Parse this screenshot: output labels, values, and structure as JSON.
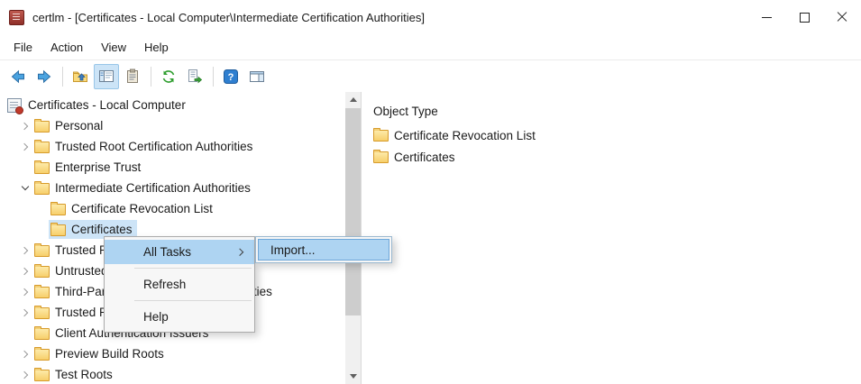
{
  "window": {
    "title": "certlm - [Certificates - Local Computer\\Intermediate Certification Authorities]",
    "controls": [
      {
        "name": "minimize"
      },
      {
        "name": "maximize"
      },
      {
        "name": "close"
      }
    ]
  },
  "menu_bar": {
    "items": [
      {
        "label": "File"
      },
      {
        "label": "Action"
      },
      {
        "label": "View"
      },
      {
        "label": "Help"
      }
    ]
  },
  "toolbar": {
    "help_glyph": "?",
    "buttons": [
      {
        "name": "back"
      },
      {
        "name": "forward"
      },
      {
        "name": "up-one-level"
      },
      {
        "name": "show-hide-console-tree",
        "active": true
      },
      {
        "name": "properties"
      },
      {
        "name": "refresh"
      },
      {
        "name": "export-list"
      },
      {
        "name": "help"
      },
      {
        "name": "show-hide-action-pane"
      }
    ]
  },
  "tree": {
    "items": [
      {
        "label": "Certificates - Local Computer",
        "level": 0,
        "chevron": "none",
        "icon": "root"
      },
      {
        "label": "Personal",
        "level": 1,
        "chevron": "collapsed",
        "icon": "folder"
      },
      {
        "label": "Trusted Root Certification Authorities",
        "level": 1,
        "chevron": "collapsed",
        "icon": "folder"
      },
      {
        "label": "Enterprise Trust",
        "level": 1,
        "chevron": "none",
        "icon": "folder"
      },
      {
        "label": "Intermediate Certification Authorities",
        "level": 1,
        "chevron": "expanded",
        "icon": "folder"
      },
      {
        "label": "Certificate Revocation List",
        "level": 2,
        "chevron": "none",
        "icon": "folder"
      },
      {
        "label": "Certificates",
        "level": 2,
        "chevron": "none",
        "icon": "folder",
        "selected": true
      },
      {
        "label": "Trusted Publishers",
        "level": 1,
        "chevron": "collapsed",
        "icon": "folder"
      },
      {
        "label": "Untrusted Certificates",
        "level": 1,
        "chevron": "collapsed",
        "icon": "folder"
      },
      {
        "label": "Third-Party Root Certification Authorities",
        "level": 1,
        "chevron": "collapsed",
        "icon": "folder"
      },
      {
        "label": "Trusted People",
        "level": 1,
        "chevron": "collapsed",
        "icon": "folder"
      },
      {
        "label": "Client Authentication Issuers",
        "level": 1,
        "chevron": "none",
        "icon": "folder"
      },
      {
        "label": "Preview Build Roots",
        "level": 1,
        "chevron": "collapsed",
        "icon": "folder"
      },
      {
        "label": "Test Roots",
        "level": 1,
        "chevron": "collapsed",
        "icon": "folder"
      }
    ]
  },
  "context_menu": {
    "items": [
      {
        "label": "All Tasks",
        "highlighted": true,
        "has_submenu": true
      },
      {
        "separator": true
      },
      {
        "label": "Refresh"
      },
      {
        "separator": true
      },
      {
        "label": "Help"
      }
    ],
    "submenu": {
      "items": [
        {
          "label": "Import...",
          "highlighted": true
        }
      ]
    }
  },
  "right_pane": {
    "header": "Object Type",
    "items": [
      {
        "label": "Certificate Revocation List"
      },
      {
        "label": "Certificates"
      }
    ]
  },
  "colors": {
    "tree_selection_bg": "#cde4f7",
    "menu_highlight_bg": "#aed4f2",
    "menu_highlight_border": "#6da6d8",
    "toolbar_active_bg": "#cce4f7",
    "folder_fill": "#f7cf6b"
  }
}
